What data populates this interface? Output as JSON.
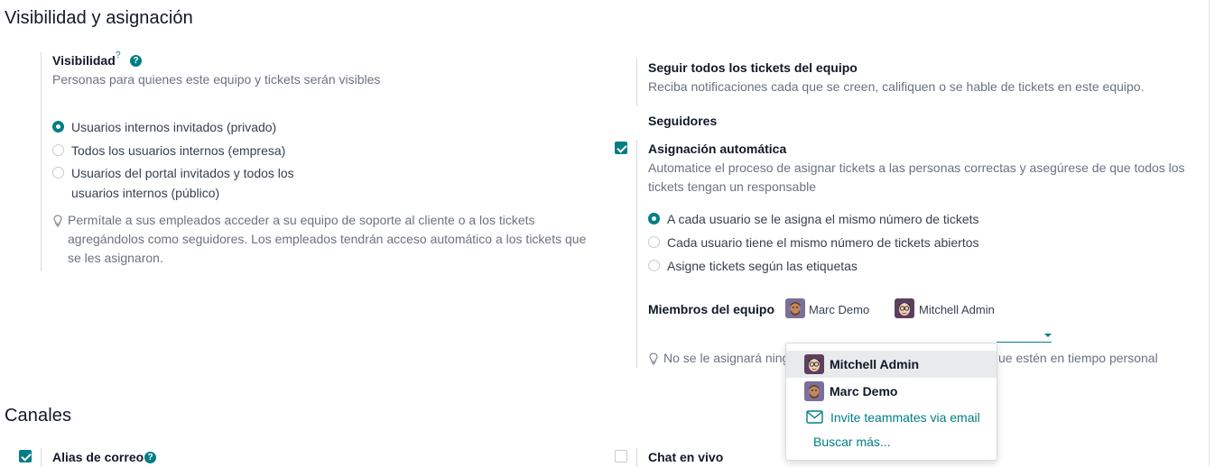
{
  "sections": {
    "visibility_title": "Visibilidad y asignación",
    "channels_title": "Canales"
  },
  "visibility": {
    "label": "Visibilidad",
    "help_marker": "?",
    "description": "Personas para quienes este equipo y tickets serán visibles",
    "options": [
      {
        "label": "Usuarios internos invitados (privado)",
        "checked": true
      },
      {
        "label": "Todos los usuarios internos (empresa)",
        "checked": false
      },
      {
        "label_line1": "Usuarios del portal invitados y todos los",
        "label_line2": "usuarios internos (público)",
        "checked": false
      }
    ],
    "hint_lines": [
      "Permítale a sus empleados acceder a su equipo de soporte al cliente o a los tickets",
      "agregándolos como seguidores. Los empleados tendrán acceso automático a los tickets que",
      "se les asignaron."
    ]
  },
  "follow": {
    "label": "Seguir todos los tickets del equipo",
    "description": "Reciba notificaciones cada que se creen, califiquen o se hable de tickets en este equipo."
  },
  "followers": {
    "label": "Seguidores"
  },
  "auto_assign": {
    "label": "Asignación automática",
    "checked": true,
    "description_line1": "Automatice el proceso de asignar tickets a las personas correctas y asegúrese de que todos los",
    "description_line2": "tickets tengan un responsable",
    "options": [
      {
        "label": "A cada usuario se le asigna el mismo número de tickets",
        "checked": true
      },
      {
        "label": "Cada usuario tiene el mismo número de tickets abiertos",
        "checked": false
      },
      {
        "label": "Asigne tickets según las etiquetas",
        "checked": false
      }
    ]
  },
  "members": {
    "label": "Miembros del equipo",
    "tags": [
      {
        "name": "Marc Demo"
      },
      {
        "name": "Mitchell Admin"
      }
    ],
    "hint_left": "No se le asignará ning",
    "hint_right": "ue estén en tiempo personal"
  },
  "dropdown": {
    "items": [
      {
        "name": "Mitchell Admin",
        "active": true
      },
      {
        "name": "Marc Demo",
        "active": false
      }
    ],
    "invite_label": "Invite teammates via email",
    "search_more": "Buscar más..."
  },
  "channels": {
    "email_alias": {
      "label": "Alias de correo",
      "checked": true
    },
    "live_chat": {
      "label": "Chat en vivo",
      "checked": false
    }
  },
  "colors": {
    "accent": "#017e84",
    "text": "#374151",
    "muted": "#6b7280"
  }
}
